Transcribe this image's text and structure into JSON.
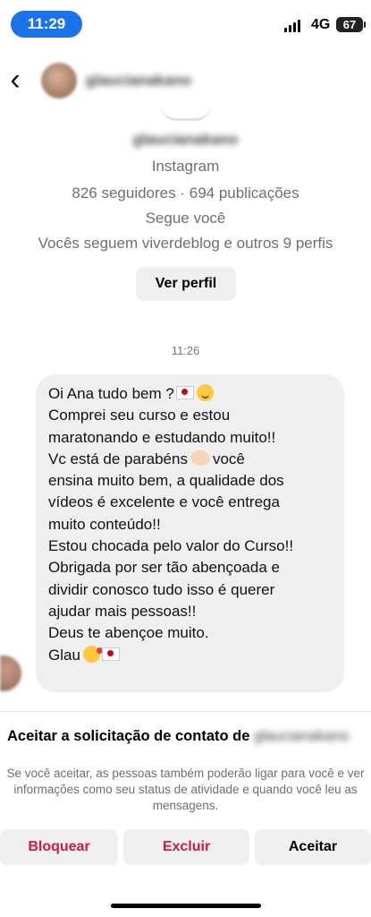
{
  "status_bar": {
    "time": "11:29",
    "network": "4G",
    "battery": "67"
  },
  "header": {
    "username": "glaucianakano"
  },
  "profile": {
    "username": "glaucianakano",
    "source": "Instagram",
    "stats": "826 seguidores · 694 publicações",
    "follow_status": "Segue você",
    "mutuals": "Vocês seguem viverdeblog e outros 9 perfis",
    "view_profile_label": "Ver perfil"
  },
  "conversation": {
    "timestamp": "11:26",
    "message_lines": {
      "l1": "Oi Ana tudo bem ?",
      "l2": "Comprei seu curso e estou",
      "l3": "maratonando e estudando muito!!",
      "l4a": "Vc está de parabéns",
      "l4b": "você",
      "l5": "ensina muito bem, a qualidade dos",
      "l6": "vídeos é excelente e você entrega",
      "l7": "muito conteúdo!!",
      "l8": "Estou chocada pelo valor do Curso!!",
      "l9": "Obrigada por ser tão abençoada e",
      "l10": "dividir conosco tudo isso é querer",
      "l11": "ajudar mais pessoas!!",
      "l12": "Deus te abençoe muito.",
      "l13": "Glau"
    }
  },
  "request": {
    "title": "Aceitar a solicitação de contato de",
    "requester": "glaucianakano",
    "description": "Se você aceitar, as pessoas também poderão ligar para você e ver informações como seu status de atividade e quando você leu as mensagens.",
    "buttons": {
      "block": "Bloquear",
      "delete": "Excluir",
      "accept": "Aceitar"
    }
  },
  "colors": {
    "time_pill": "#1a73e8",
    "danger": "#d4193f",
    "bubble": "#efefef"
  }
}
